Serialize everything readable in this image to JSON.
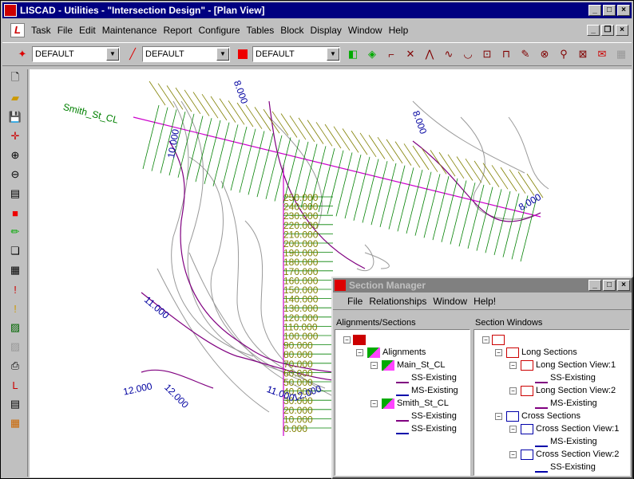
{
  "app": {
    "title": "LISCAD - Utilities - \"Intersection Design\" - [Plan View]"
  },
  "menu": [
    "Task",
    "File",
    "Edit",
    "Maintenance",
    "Report",
    "Configure",
    "Tables",
    "Block",
    "Display",
    "Window",
    "Help"
  ],
  "toolbar": {
    "combo1": "DEFAULT",
    "combo2": "DEFAULT",
    "combo3": "DEFAULT"
  },
  "plan": {
    "road_label": "Smith_St_CL",
    "chainages": [
      "250.000",
      "240.000",
      "230.000",
      "220.000",
      "210.000",
      "200.000",
      "190.000",
      "180.000",
      "170.000",
      "160.000",
      "150.000",
      "140.000",
      "130.000",
      "120.000",
      "110.000",
      "100.000",
      "90.000",
      "80.000",
      "70.000",
      "60.000",
      "50.000",
      "40.000",
      "30.000",
      "20.000",
      "10.000",
      "0.000"
    ],
    "contours": [
      "8.000",
      "8.000",
      "8.000",
      "10.000",
      "11.000",
      "11.000",
      "12.000",
      "12.000",
      "12.000"
    ]
  },
  "section_manager": {
    "title": "Section Manager",
    "menu": [
      "File",
      "Relationships",
      "Window",
      "Help!"
    ],
    "left_header": "Alignments/Sections",
    "right_header": "Section Windows",
    "left_tree": [
      "Alignments",
      "Main_St_CL",
      "SS-Existing",
      "MS-Existing",
      "Smith_St_CL",
      "SS-Existing",
      "SS-Existing"
    ],
    "right_tree": [
      "Long Sections",
      "Long Section View:1",
      "SS-Existing",
      "Long Section View:2",
      "MS-Existing",
      "Cross Sections",
      "Cross Section View:1",
      "MS-Existing",
      "Cross Section View:2",
      "SS-Existing"
    ]
  },
  "colors": {
    "titlebar": "#000080",
    "alignment": "#cc00cc",
    "chainage": "#808000",
    "crosslines": "#008000",
    "contours_label": "#0000a0"
  }
}
